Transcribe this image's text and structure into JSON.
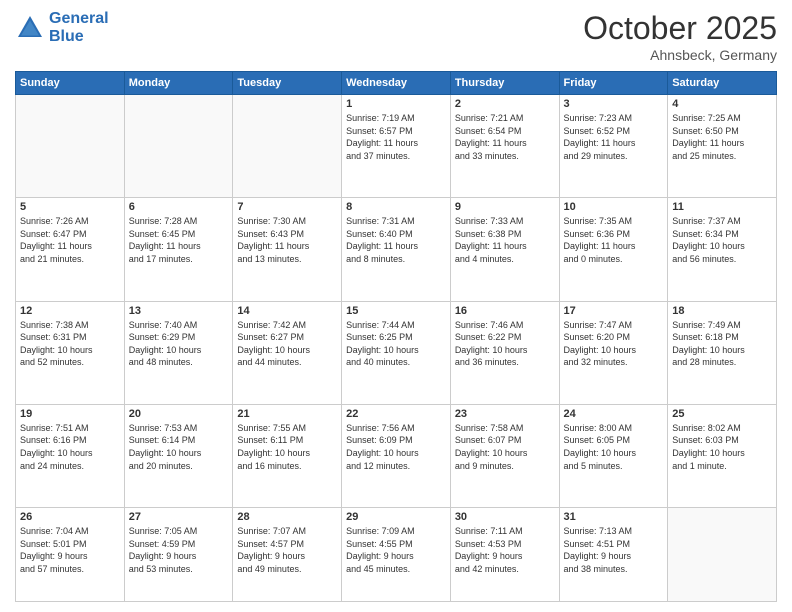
{
  "header": {
    "logo_line1": "General",
    "logo_line2": "Blue",
    "month": "October 2025",
    "location": "Ahnsbeck, Germany"
  },
  "weekdays": [
    "Sunday",
    "Monday",
    "Tuesday",
    "Wednesday",
    "Thursday",
    "Friday",
    "Saturday"
  ],
  "weeks": [
    [
      {
        "day": "",
        "info": ""
      },
      {
        "day": "",
        "info": ""
      },
      {
        "day": "",
        "info": ""
      },
      {
        "day": "1",
        "info": "Sunrise: 7:19 AM\nSunset: 6:57 PM\nDaylight: 11 hours\nand 37 minutes."
      },
      {
        "day": "2",
        "info": "Sunrise: 7:21 AM\nSunset: 6:54 PM\nDaylight: 11 hours\nand 33 minutes."
      },
      {
        "day": "3",
        "info": "Sunrise: 7:23 AM\nSunset: 6:52 PM\nDaylight: 11 hours\nand 29 minutes."
      },
      {
        "day": "4",
        "info": "Sunrise: 7:25 AM\nSunset: 6:50 PM\nDaylight: 11 hours\nand 25 minutes."
      }
    ],
    [
      {
        "day": "5",
        "info": "Sunrise: 7:26 AM\nSunset: 6:47 PM\nDaylight: 11 hours\nand 21 minutes."
      },
      {
        "day": "6",
        "info": "Sunrise: 7:28 AM\nSunset: 6:45 PM\nDaylight: 11 hours\nand 17 minutes."
      },
      {
        "day": "7",
        "info": "Sunrise: 7:30 AM\nSunset: 6:43 PM\nDaylight: 11 hours\nand 13 minutes."
      },
      {
        "day": "8",
        "info": "Sunrise: 7:31 AM\nSunset: 6:40 PM\nDaylight: 11 hours\nand 8 minutes."
      },
      {
        "day": "9",
        "info": "Sunrise: 7:33 AM\nSunset: 6:38 PM\nDaylight: 11 hours\nand 4 minutes."
      },
      {
        "day": "10",
        "info": "Sunrise: 7:35 AM\nSunset: 6:36 PM\nDaylight: 11 hours\nand 0 minutes."
      },
      {
        "day": "11",
        "info": "Sunrise: 7:37 AM\nSunset: 6:34 PM\nDaylight: 10 hours\nand 56 minutes."
      }
    ],
    [
      {
        "day": "12",
        "info": "Sunrise: 7:38 AM\nSunset: 6:31 PM\nDaylight: 10 hours\nand 52 minutes."
      },
      {
        "day": "13",
        "info": "Sunrise: 7:40 AM\nSunset: 6:29 PM\nDaylight: 10 hours\nand 48 minutes."
      },
      {
        "day": "14",
        "info": "Sunrise: 7:42 AM\nSunset: 6:27 PM\nDaylight: 10 hours\nand 44 minutes."
      },
      {
        "day": "15",
        "info": "Sunrise: 7:44 AM\nSunset: 6:25 PM\nDaylight: 10 hours\nand 40 minutes."
      },
      {
        "day": "16",
        "info": "Sunrise: 7:46 AM\nSunset: 6:22 PM\nDaylight: 10 hours\nand 36 minutes."
      },
      {
        "day": "17",
        "info": "Sunrise: 7:47 AM\nSunset: 6:20 PM\nDaylight: 10 hours\nand 32 minutes."
      },
      {
        "day": "18",
        "info": "Sunrise: 7:49 AM\nSunset: 6:18 PM\nDaylight: 10 hours\nand 28 minutes."
      }
    ],
    [
      {
        "day": "19",
        "info": "Sunrise: 7:51 AM\nSunset: 6:16 PM\nDaylight: 10 hours\nand 24 minutes."
      },
      {
        "day": "20",
        "info": "Sunrise: 7:53 AM\nSunset: 6:14 PM\nDaylight: 10 hours\nand 20 minutes."
      },
      {
        "day": "21",
        "info": "Sunrise: 7:55 AM\nSunset: 6:11 PM\nDaylight: 10 hours\nand 16 minutes."
      },
      {
        "day": "22",
        "info": "Sunrise: 7:56 AM\nSunset: 6:09 PM\nDaylight: 10 hours\nand 12 minutes."
      },
      {
        "day": "23",
        "info": "Sunrise: 7:58 AM\nSunset: 6:07 PM\nDaylight: 10 hours\nand 9 minutes."
      },
      {
        "day": "24",
        "info": "Sunrise: 8:00 AM\nSunset: 6:05 PM\nDaylight: 10 hours\nand 5 minutes."
      },
      {
        "day": "25",
        "info": "Sunrise: 8:02 AM\nSunset: 6:03 PM\nDaylight: 10 hours\nand 1 minute."
      }
    ],
    [
      {
        "day": "26",
        "info": "Sunrise: 7:04 AM\nSunset: 5:01 PM\nDaylight: 9 hours\nand 57 minutes."
      },
      {
        "day": "27",
        "info": "Sunrise: 7:05 AM\nSunset: 4:59 PM\nDaylight: 9 hours\nand 53 minutes."
      },
      {
        "day": "28",
        "info": "Sunrise: 7:07 AM\nSunset: 4:57 PM\nDaylight: 9 hours\nand 49 minutes."
      },
      {
        "day": "29",
        "info": "Sunrise: 7:09 AM\nSunset: 4:55 PM\nDaylight: 9 hours\nand 45 minutes."
      },
      {
        "day": "30",
        "info": "Sunrise: 7:11 AM\nSunset: 4:53 PM\nDaylight: 9 hours\nand 42 minutes."
      },
      {
        "day": "31",
        "info": "Sunrise: 7:13 AM\nSunset: 4:51 PM\nDaylight: 9 hours\nand 38 minutes."
      },
      {
        "day": "",
        "info": ""
      }
    ]
  ]
}
